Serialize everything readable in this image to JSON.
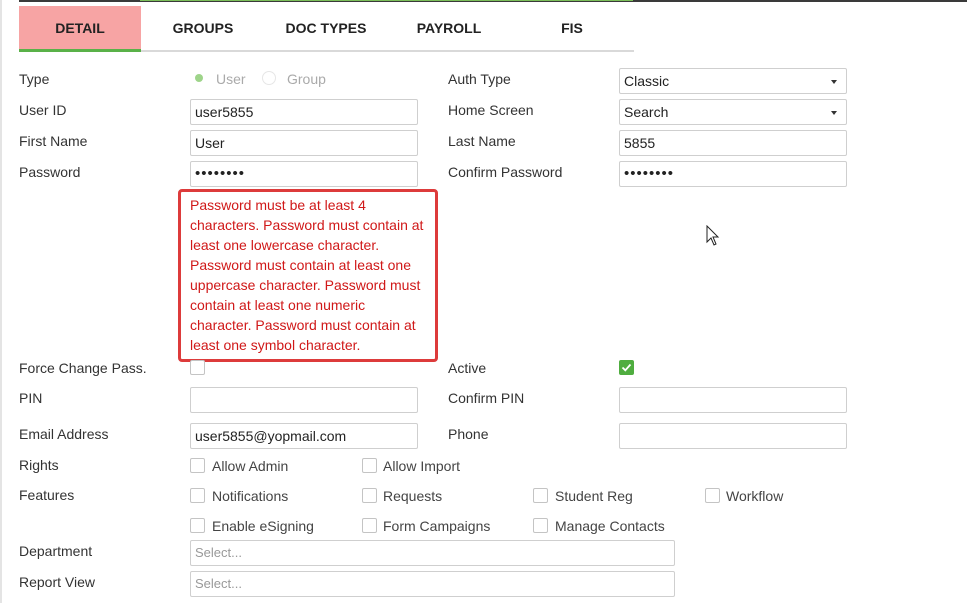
{
  "tabs": [
    {
      "label": "DETAIL",
      "active": true
    },
    {
      "label": "GROUPS",
      "active": false
    },
    {
      "label": "DOC TYPES",
      "active": false
    },
    {
      "label": "PAYROLL",
      "active": false
    },
    {
      "label": "FIS",
      "active": false
    }
  ],
  "colors": {
    "active_tab_bg": "#f7a4a4",
    "active_tab_underline": "#59b148",
    "error": "#d01818",
    "checkbox_on": "#4fad3f"
  },
  "form": {
    "type": {
      "label": "Type",
      "options": [
        "User",
        "Group"
      ],
      "selected": "User"
    },
    "auth_type": {
      "label": "Auth Type",
      "value": "Classic"
    },
    "user_id": {
      "label": "User ID",
      "value": "user5855"
    },
    "home_screen": {
      "label": "Home Screen",
      "value": "Search"
    },
    "first_name": {
      "label": "First Name",
      "value": "User"
    },
    "last_name": {
      "label": "Last Name",
      "value": "5855"
    },
    "password": {
      "label": "Password",
      "value": "••••••••"
    },
    "confirm_password": {
      "label": "Confirm Password",
      "value": "••••••••"
    },
    "password_error": "Password must be at least 4 characters. Password must contain at least one lowercase character. Password must contain at least one uppercase character. Password must contain at least one numeric character. Password must contain at least one symbol character.",
    "force_change_pass": {
      "label": "Force Change Pass.",
      "checked": false
    },
    "active": {
      "label": "Active",
      "checked": true
    },
    "pin": {
      "label": "PIN",
      "value": ""
    },
    "confirm_pin": {
      "label": "Confirm PIN",
      "value": ""
    },
    "email": {
      "label": "Email Address",
      "value": "user5855@yopmail.com"
    },
    "phone": {
      "label": "Phone",
      "value": ""
    },
    "rights": {
      "label": "Rights",
      "options": [
        {
          "label": "Allow Admin",
          "checked": false
        },
        {
          "label": "Allow Import",
          "checked": false
        }
      ]
    },
    "features": {
      "label": "Features",
      "options": [
        {
          "label": "Notifications",
          "checked": false
        },
        {
          "label": "Requests",
          "checked": false
        },
        {
          "label": "Student Reg",
          "checked": false
        },
        {
          "label": "Workflow",
          "checked": false
        },
        {
          "label": "Enable eSigning",
          "checked": false
        },
        {
          "label": "Form Campaigns",
          "checked": false
        },
        {
          "label": "Manage Contacts",
          "checked": false
        }
      ]
    },
    "department": {
      "label": "Department",
      "placeholder": "Select..."
    },
    "report_view": {
      "label": "Report View",
      "placeholder": "Select..."
    }
  }
}
